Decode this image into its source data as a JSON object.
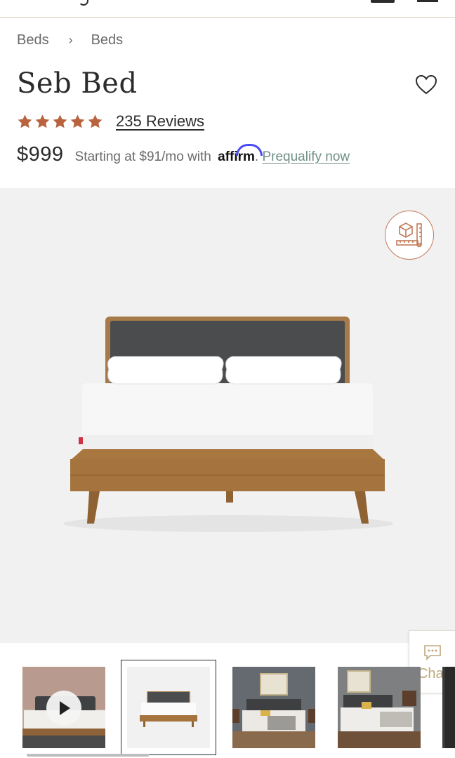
{
  "breadcrumb": {
    "items": [
      "Beds",
      "Beds"
    ],
    "separator": "›"
  },
  "product": {
    "title": "Seb Bed",
    "rating": 5,
    "reviews_label": "235 Reviews",
    "price": "$999",
    "financing_prefix": "Starting at $91/mo with",
    "financing_brand": "affirm",
    "financing_link": "Prequalify now"
  },
  "chat": {
    "label": "Chat"
  },
  "thumbnails": [
    {
      "name": "video-lifestyle",
      "type": "video"
    },
    {
      "name": "front-studio",
      "selected": true
    },
    {
      "name": "bedroom-grey-wall"
    },
    {
      "name": "bedroom-angle"
    },
    {
      "name": "partial-next"
    }
  ],
  "colors": {
    "accent": "#b8633e",
    "star": "#b8633e",
    "link_green": "#6f8f86",
    "gallery_bg": "#f1f1f1"
  }
}
